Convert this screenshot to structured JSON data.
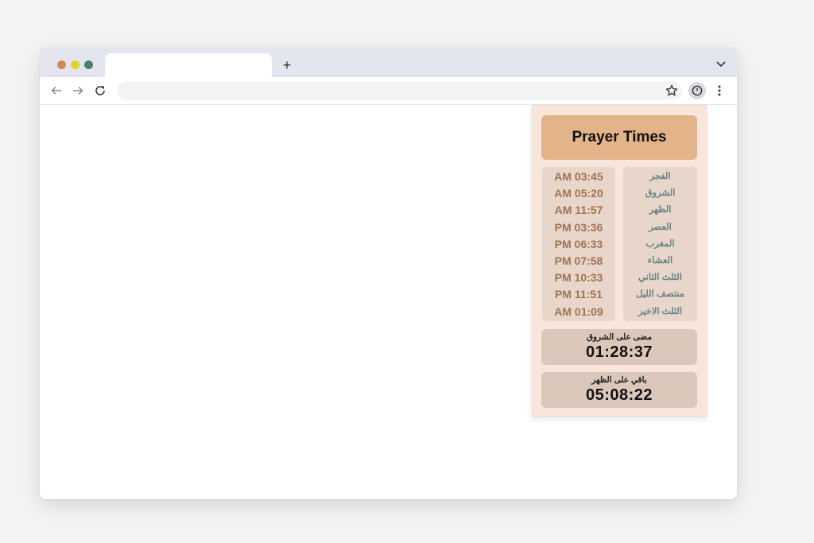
{
  "browser": {
    "tab_title": "",
    "new_tab_label": "+",
    "address": ""
  },
  "popup": {
    "title": "Prayer Times",
    "prayers": [
      {
        "name": "الفجر",
        "time": "AM 03:45"
      },
      {
        "name": "الشروق",
        "time": "AM 05:20"
      },
      {
        "name": "الظهر",
        "time": "AM 11:57"
      },
      {
        "name": "العصر",
        "time": "PM 03:36"
      },
      {
        "name": "المغرب",
        "time": "PM 06:33"
      },
      {
        "name": "العشاء",
        "time": "PM 07:58"
      },
      {
        "name": "الثلث الثاني",
        "time": "PM 10:33"
      },
      {
        "name": "منتصف الليل",
        "time": "PM 11:51"
      },
      {
        "name": "الثلث الاخير",
        "time": "AM 01:09"
      }
    ],
    "elapsed": {
      "label": "مضى على الشروق",
      "value": "01:28:37"
    },
    "remaining": {
      "label": "باقي على الظهر",
      "value": "05:08:22"
    }
  },
  "colors": {
    "accent": "#e3b48a",
    "popup_bg": "#f8e6dc",
    "time_text": "#9c7553",
    "name_text": "#6a8385"
  },
  "icons": {
    "back": "arrow-left-icon",
    "forward": "arrow-right-icon",
    "reload": "reload-icon",
    "bookmark": "star-icon",
    "extension": "clock-icon",
    "menu": "kebab-menu-icon",
    "tab_dropdown": "chevron-down-icon"
  }
}
